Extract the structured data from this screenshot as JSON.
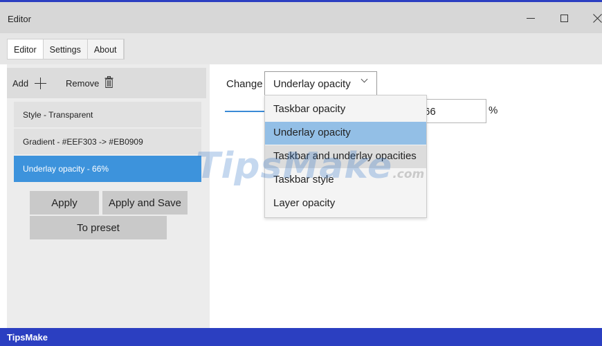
{
  "window": {
    "title": "Editor"
  },
  "tabs": [
    {
      "label": "Editor",
      "active": true
    },
    {
      "label": "Settings",
      "active": false
    },
    {
      "label": "About",
      "active": false
    }
  ],
  "sidebar": {
    "add_label": "Add",
    "remove_label": "Remove",
    "presets": [
      {
        "label": "Style - Transparent",
        "selected": false
      },
      {
        "label": "Gradient - #EEF303 -> #EB0909",
        "selected": false
      },
      {
        "label": "Underlay opacity - 66%",
        "selected": true
      }
    ],
    "apply_label": "Apply",
    "apply_save_label": "Apply and Save",
    "to_preset_label": "To preset"
  },
  "editor": {
    "change_label": "Change",
    "selected_option": "Underlay opacity",
    "value": "66",
    "unit": "%",
    "slider_value_percent": 66,
    "options": [
      "Taskbar opacity",
      "Underlay opacity",
      "Taskbar and underlay opacities",
      "Taskbar style",
      "Layer opacity"
    ]
  },
  "watermark": {
    "main": "TipsMake",
    "suffix": ".com"
  },
  "statusbar": {
    "brand": "TipsMake"
  },
  "colors": {
    "accent_blue": "#2b3fc1",
    "selection_blue": "#3d93dc",
    "dropdown_selection": "#93bfe6"
  },
  "icons": [
    "minimize-icon",
    "maximize-icon",
    "close-icon",
    "plus-icon",
    "trash-icon",
    "chevron-down-icon"
  ]
}
